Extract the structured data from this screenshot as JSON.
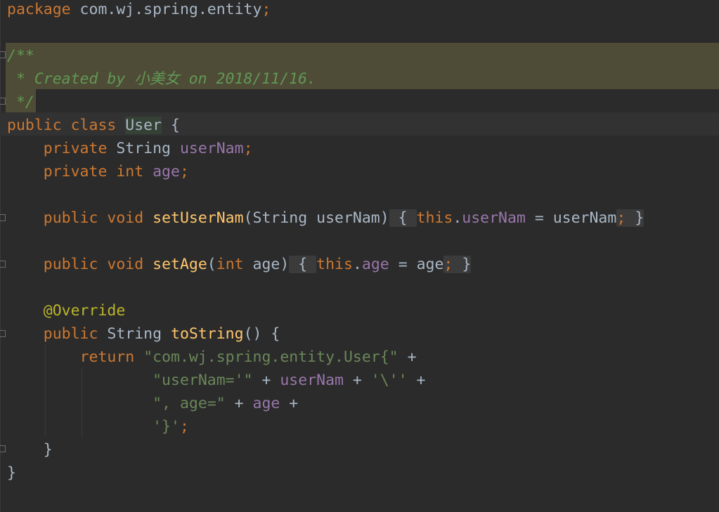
{
  "editor": {
    "package_kw": "package",
    "package_name": " com.wj.spring.entity",
    "semicolon": ";",
    "doc_open": "/**",
    "doc_body": " * Created by 小美女 on 2018/11/16.",
    "doc_close": " */",
    "class_public": "public",
    "class_kw": " class ",
    "class_name": "User",
    "class_brace": " {",
    "f1_private": "private",
    "f1_type": " String ",
    "f1_name": "userNam",
    "f2_private": "private",
    "f2_type": " int",
    "f2_name": " age",
    "m1_public": "public",
    "m1_void": " void ",
    "m1_name": "setUserNam",
    "m1_params": "(String userNam)",
    "brace_open": "{ ",
    "this_kw": "this",
    "dot": ".",
    "m1_assign": " = userNam",
    "brace_close": " }",
    "m2_public": "public",
    "m2_void": " void ",
    "m2_name": "setAge",
    "m2_paren_open": "(",
    "m2_int": "int",
    "m2_param": " age)",
    "m2_field": "age",
    "m2_assign": " = age",
    "annotation": "@Override",
    "m3_public": "public",
    "m3_type": " String ",
    "m3_name": "toString",
    "m3_rest": "() {",
    "return_kw": "return",
    "s1": "\"com.wj.spring.entity.User{\"",
    "plus": " +",
    "s2": "\"userNam='\"",
    "plus_mid": " + ",
    "s2_field": "userNam",
    "s2_char": "'\\''",
    "s3": "\", age=\"",
    "s3_field": "age",
    "s4": "'}'",
    "method_close": "}",
    "class_close": "}"
  },
  "colors": {
    "background": "#2b2b2b",
    "keyword": "#cc7832",
    "comment": "#629755",
    "string": "#6a8759",
    "field": "#9876aa",
    "method": "#ffc66d",
    "annotation": "#bbb529",
    "text": "#a9b7c6"
  }
}
